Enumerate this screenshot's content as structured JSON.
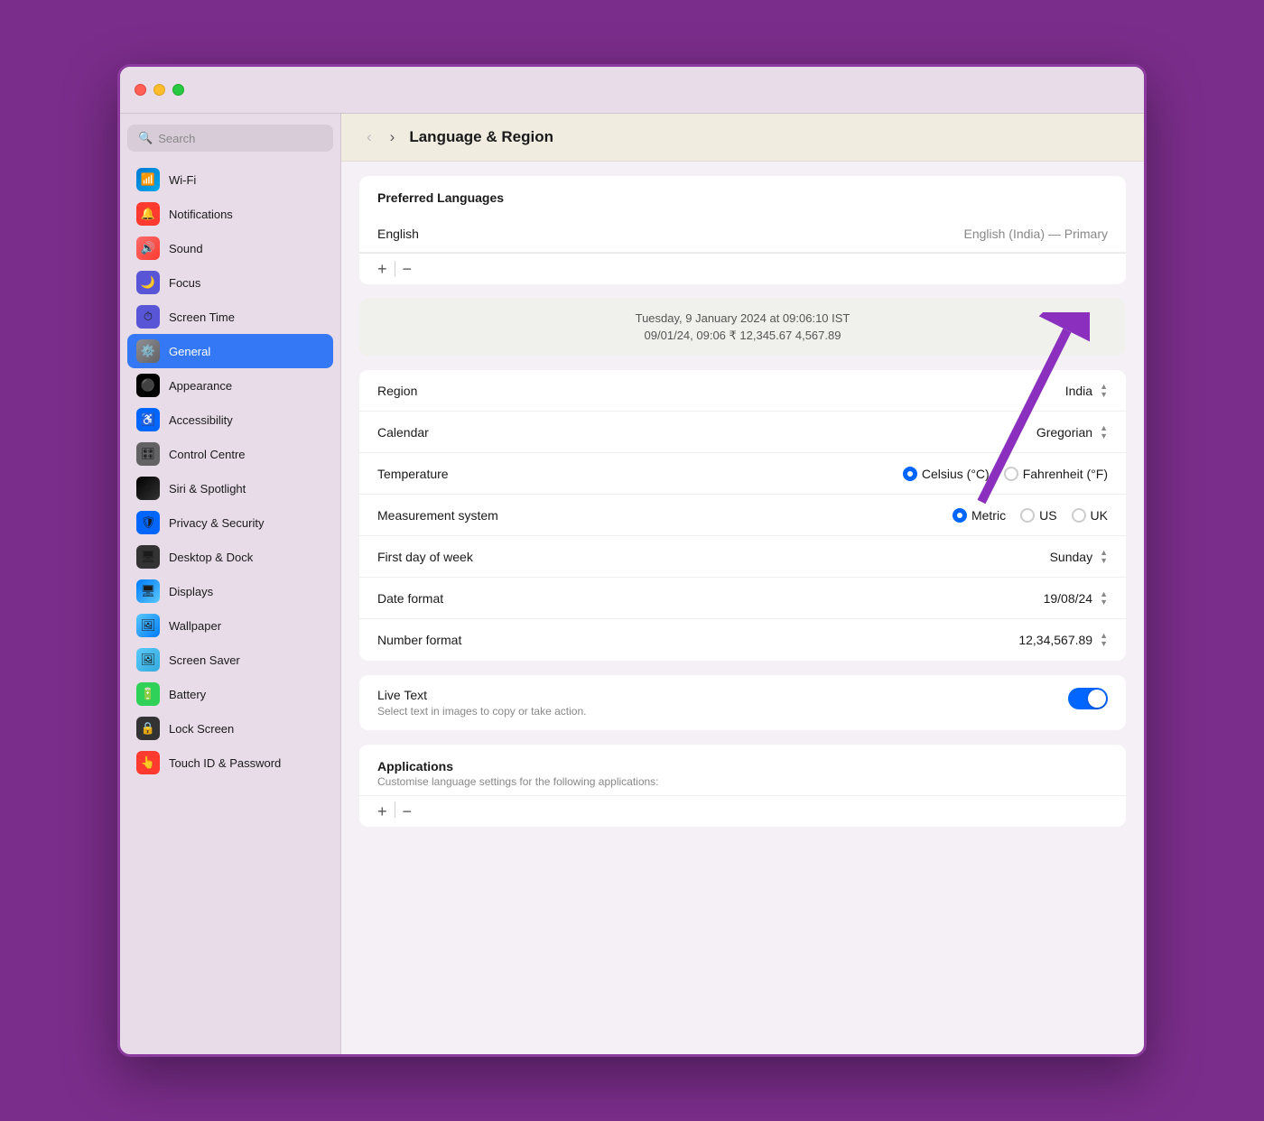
{
  "window": {
    "title": "Language & Region"
  },
  "titlebar": {
    "close": "close",
    "minimize": "minimize",
    "maximize": "maximize"
  },
  "sidebar": {
    "search_placeholder": "Search",
    "items": [
      {
        "id": "wifi",
        "label": "Wi-Fi",
        "icon": "wifi",
        "active": false
      },
      {
        "id": "notifications",
        "label": "Notifications",
        "icon": "notif",
        "active": false
      },
      {
        "id": "sound",
        "label": "Sound",
        "icon": "sound",
        "active": false
      },
      {
        "id": "focus",
        "label": "Focus",
        "icon": "focus",
        "active": false
      },
      {
        "id": "screentime",
        "label": "Screen Time",
        "icon": "screentime",
        "active": false
      },
      {
        "id": "general",
        "label": "General",
        "icon": "general",
        "active": true
      },
      {
        "id": "appearance",
        "label": "Appearance",
        "icon": "appearance",
        "active": false
      },
      {
        "id": "accessibility",
        "label": "Accessibility",
        "icon": "accessibility",
        "active": false
      },
      {
        "id": "control",
        "label": "Control Centre",
        "icon": "control",
        "active": false
      },
      {
        "id": "siri",
        "label": "Siri & Spotlight",
        "icon": "siri",
        "active": false
      },
      {
        "id": "privacy",
        "label": "Privacy & Security",
        "icon": "privacy",
        "active": false
      },
      {
        "id": "desktop",
        "label": "Desktop & Dock",
        "icon": "desktop",
        "active": false
      },
      {
        "id": "displays",
        "label": "Displays",
        "icon": "displays",
        "active": false
      },
      {
        "id": "wallpaper",
        "label": "Wallpaper",
        "icon": "wallpaper",
        "active": false
      },
      {
        "id": "screensaver",
        "label": "Screen Saver",
        "icon": "screensaver",
        "active": false
      },
      {
        "id": "battery",
        "label": "Battery",
        "icon": "battery",
        "active": false
      },
      {
        "id": "lockscreen",
        "label": "Lock Screen",
        "icon": "lockscreen",
        "active": false
      },
      {
        "id": "touchid",
        "label": "Touch ID & Password",
        "icon": "touchid",
        "active": false
      }
    ]
  },
  "header": {
    "back_label": "‹",
    "forward_label": "›",
    "title": "Language & Region"
  },
  "preferred_languages": {
    "section_title": "Preferred Languages",
    "language_label": "English",
    "language_value": "English (India) — Primary",
    "add_btn": "+",
    "remove_btn": "−"
  },
  "date_preview": {
    "line1": "Tuesday, 9 January 2024 at 09:06:10 IST",
    "line2": "09/01/24, 09:06    ₹ 12,345.67    4,567.89"
  },
  "region_row": {
    "label": "Region",
    "value": "India"
  },
  "calendar_row": {
    "label": "Calendar",
    "value": "Gregorian"
  },
  "temperature_row": {
    "label": "Temperature",
    "options": [
      {
        "label": "Celsius (°C)",
        "checked": true
      },
      {
        "label": "Fahrenheit (°F)",
        "checked": false
      }
    ]
  },
  "measurement_row": {
    "label": "Measurement system",
    "options": [
      {
        "label": "Metric",
        "checked": true
      },
      {
        "label": "US",
        "checked": false
      },
      {
        "label": "UK",
        "checked": false
      }
    ]
  },
  "first_day_row": {
    "label": "First day of week",
    "value": "Sunday"
  },
  "date_format_row": {
    "label": "Date format",
    "value": "19/08/24"
  },
  "number_format_row": {
    "label": "Number format",
    "value": "12,34,567.89"
  },
  "live_text": {
    "title": "Live Text",
    "description": "Select text in images to copy or take action.",
    "enabled": true
  },
  "applications": {
    "title": "Applications",
    "description": "Customise language settings for the following applications:",
    "add_btn": "+",
    "remove_btn": "−"
  }
}
